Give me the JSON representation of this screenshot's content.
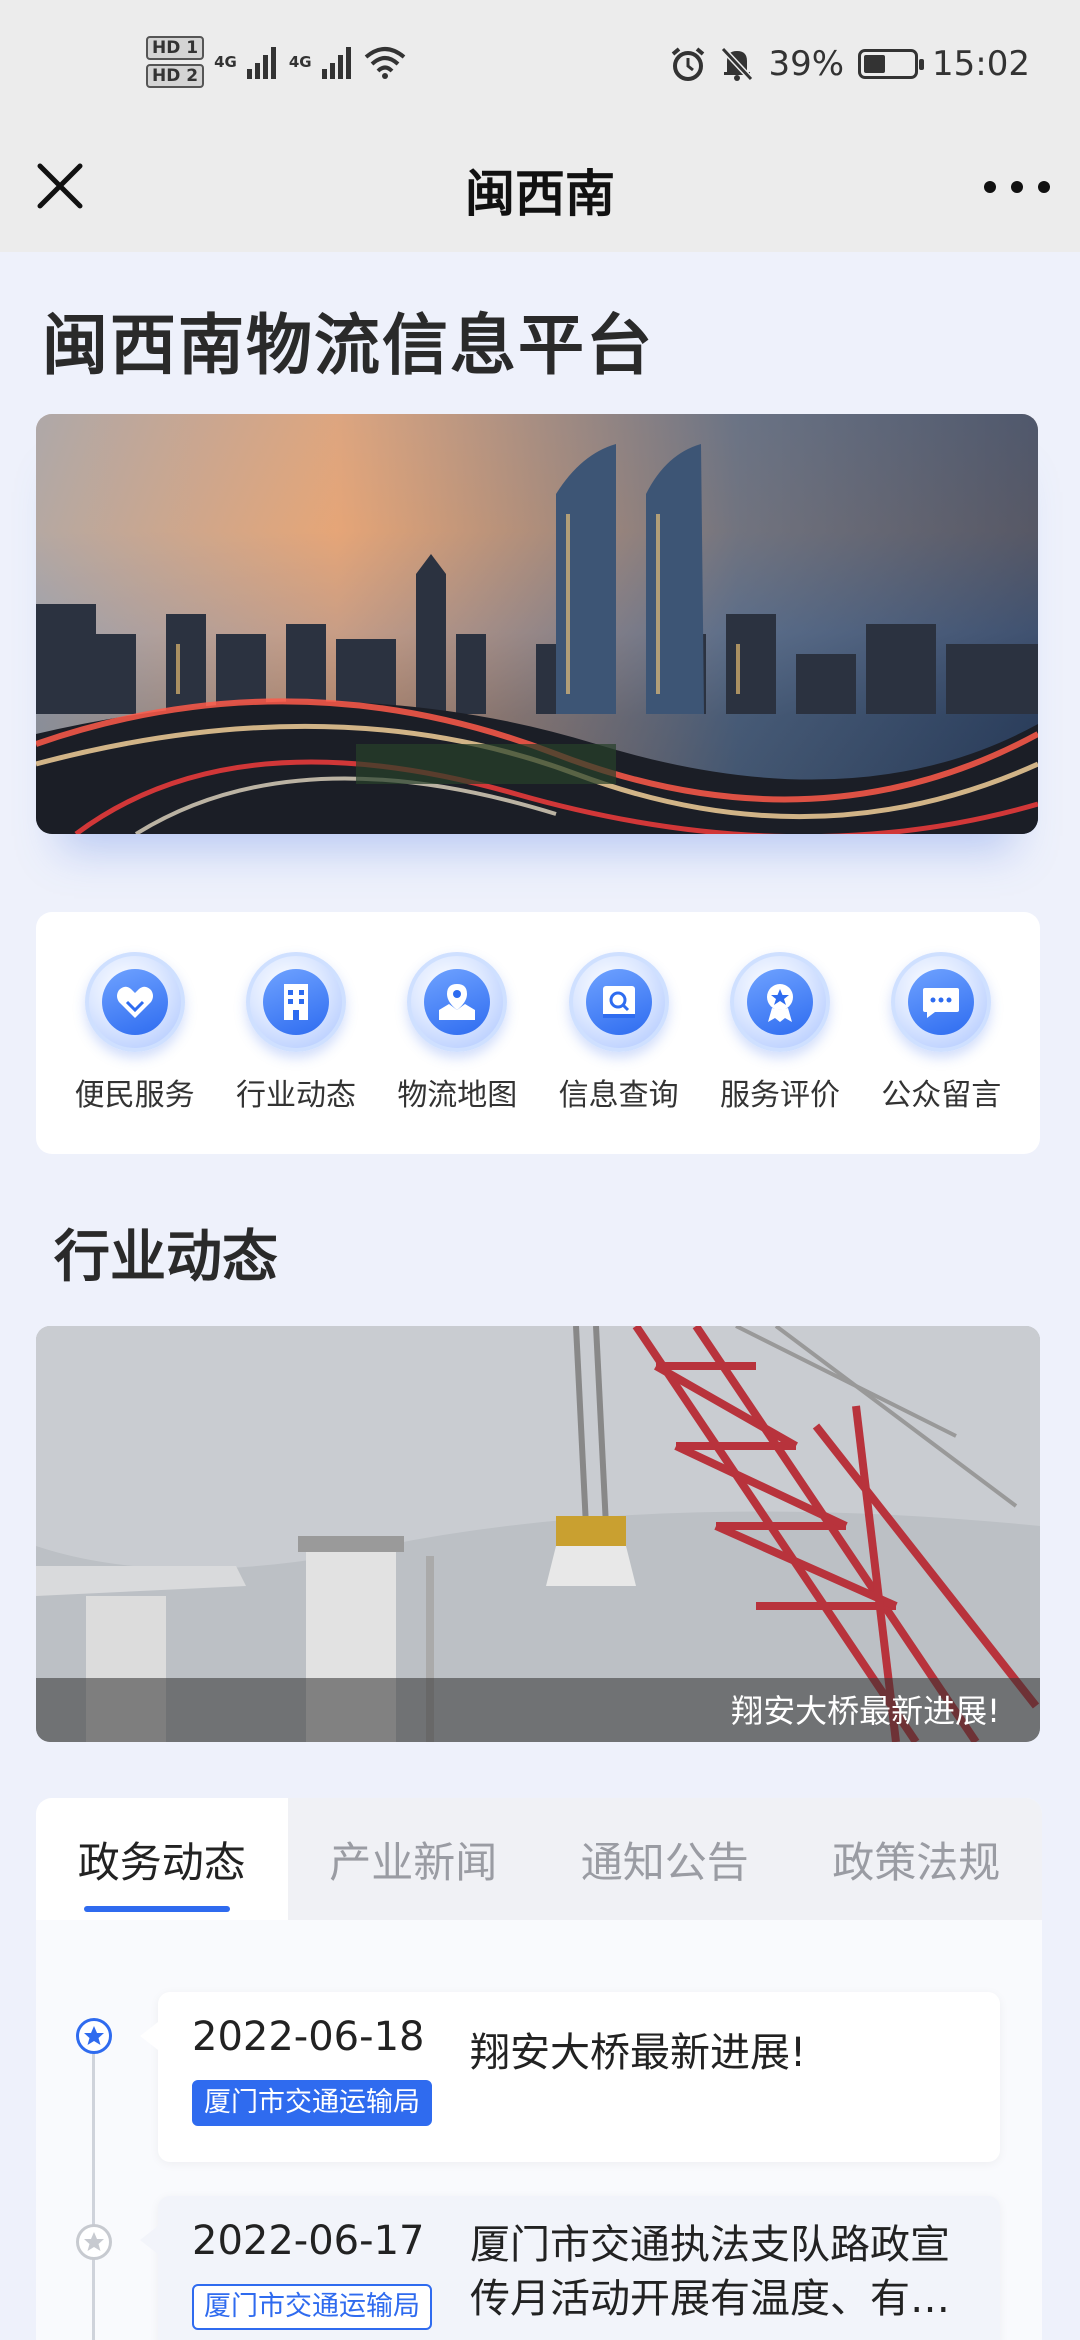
{
  "status_bar": {
    "hd1": "HD 1",
    "hd2": "HD 2",
    "net1": "4G",
    "net2": "4G",
    "battery_text": "39%",
    "battery_level": 0.39,
    "time": "15:02"
  },
  "nav": {
    "title": "闽西南"
  },
  "page": {
    "title": "闽西南物流信息平台"
  },
  "services": [
    {
      "label": "便民服务",
      "icon": "handshake-heart-icon"
    },
    {
      "label": "行业动态",
      "icon": "building-icon"
    },
    {
      "label": "物流地图",
      "icon": "map-pin-icon"
    },
    {
      "label": "信息查询",
      "icon": "book-search-icon"
    },
    {
      "label": "服务评价",
      "icon": "award-medal-icon"
    },
    {
      "label": "公众留言",
      "icon": "chat-bubble-icon"
    }
  ],
  "industry": {
    "section_title": "行业动态",
    "banner_caption": "翔安大桥最新进展!"
  },
  "tabs": [
    {
      "label": "政务动态",
      "active": true
    },
    {
      "label": "产业新闻",
      "active": false
    },
    {
      "label": "通知公告",
      "active": false
    },
    {
      "label": "政策法规",
      "active": false
    }
  ],
  "news": [
    {
      "date": "2022-06-18",
      "source": "厦门市交通运输局",
      "title": "翔安大桥最新进展!"
    },
    {
      "date": "2022-06-17",
      "source": "厦门市交通运输局",
      "title": "厦门市交通执法支队路政宣传月活动开展有温度、有…"
    }
  ],
  "colors": {
    "accent": "#2f6bef",
    "page_bg": "#eef1fb",
    "bar_bg": "#ececec"
  }
}
